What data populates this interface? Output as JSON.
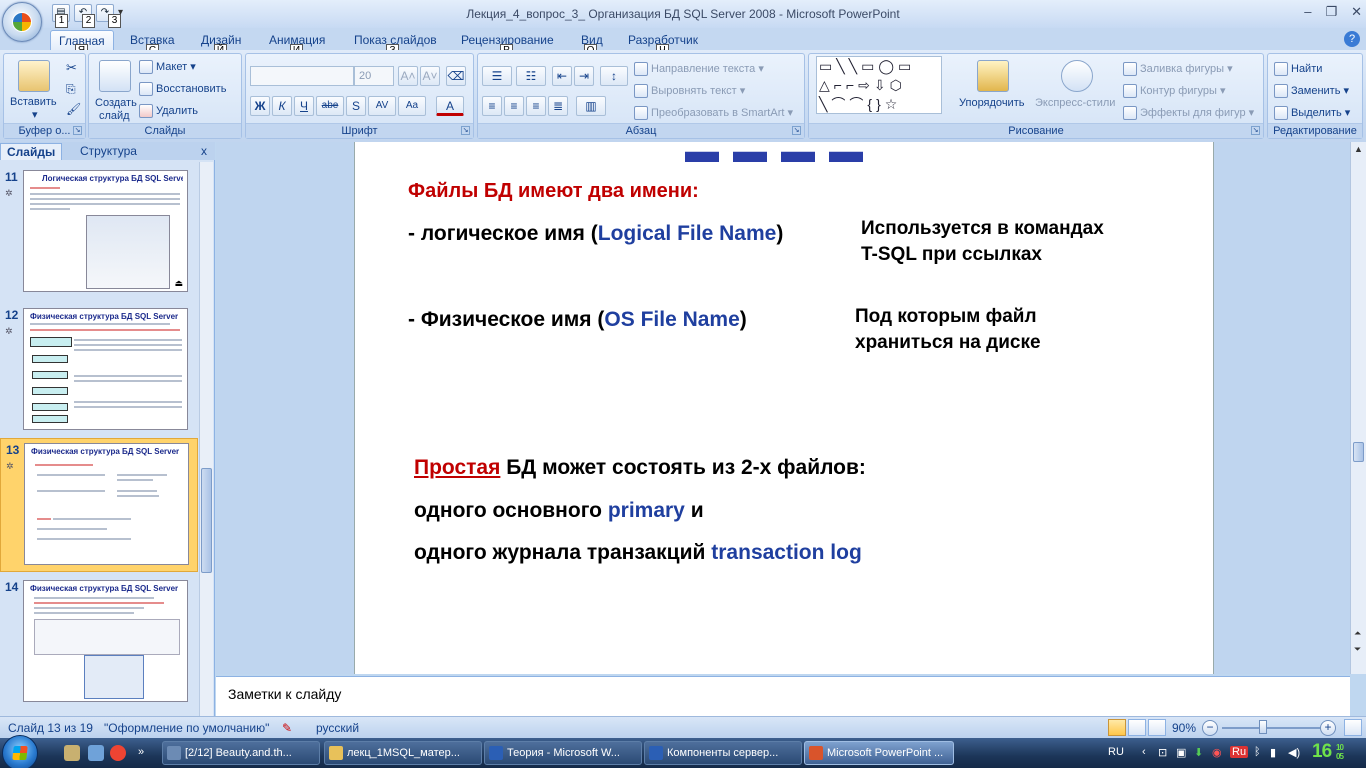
{
  "window": {
    "title": "Лекция_4_вопрос_3_ Организация БД SQL Server 2008 - Microsoft PowerPoint",
    "qat_keytips": [
      "1",
      "2",
      "3"
    ]
  },
  "ribbon": {
    "tabs": [
      {
        "label": "Главная",
        "keytip": "Я"
      },
      {
        "label": "Вставка",
        "keytip": "С"
      },
      {
        "label": "Дизайн",
        "keytip": "Й"
      },
      {
        "label": "Анимация",
        "keytip": "И"
      },
      {
        "label": "Показ слайдов",
        "keytip": "З"
      },
      {
        "label": "Рецензирование",
        "keytip": "Р"
      },
      {
        "label": "Вид",
        "keytip": "О"
      },
      {
        "label": "Разработчик",
        "keytip": "Ч"
      }
    ],
    "clipboard": {
      "paste": "Вставить",
      "label": "Буфер о..."
    },
    "slides": {
      "new_slide_1": "Создать",
      "new_slide_2": "слайд",
      "layout": "Макет",
      "reset": "Восстановить",
      "delete": "Удалить",
      "label": "Слайды"
    },
    "font": {
      "size": "20",
      "label": "Шрифт",
      "bold": "Ж",
      "italic": "К",
      "underline": "Ч",
      "strike": "abe",
      "shadow": "S",
      "spacing": "AV",
      "case": "Aa",
      "color": "A"
    },
    "paragraph": {
      "text_direction": "Направление текста",
      "align_text": "Выровнять текст",
      "smartart": "Преобразовать в SmartArt",
      "label": "Абзац"
    },
    "drawing": {
      "arrange": "Упорядочить",
      "quick_styles": "Экспресс-стили",
      "fill": "Заливка фигуры",
      "outline": "Контур фигуры",
      "effects": "Эффекты для фигур",
      "label": "Рисование"
    },
    "editing": {
      "find": "Найти",
      "replace": "Заменить",
      "select": "Выделить",
      "label": "Редактирование"
    }
  },
  "panel": {
    "tab_slides": "Слайды",
    "tab_outline": "Структура",
    "thumbnails": [
      {
        "num": "11",
        "title": "Логическая структура БД SQL Server"
      },
      {
        "num": "12",
        "title": "Физическая структура БД SQL Server"
      },
      {
        "num": "13",
        "title": "Физическая структура БД SQL Server"
      },
      {
        "num": "14",
        "title": "Физическая структура БД SQL Server"
      }
    ]
  },
  "slide": {
    "files_two_names": "Файлы БД имеют два имени:",
    "logical_prefix": "- логическое имя (",
    "logical_term": "Logical File Name",
    "close_paren": ")",
    "logical_note_1": "Используется в командах",
    "logical_note_2": "T-SQL при ссылках",
    "physical_prefix": "- Физическое имя (",
    "physical_term": "OS File Name",
    "physical_note_1": "Под которым файл",
    "physical_note_2": "храниться на диске",
    "simple_word": "Простая",
    "simple_rest": " БД может состоять из 2-х файлов:",
    "line2_a": "одного основного ",
    "line2_b": "primary",
    "line2_c": " и",
    "line3_a": "одного журнала транзакций ",
    "line3_b": "transaction log"
  },
  "notes": {
    "placeholder": "Заметки к слайду"
  },
  "status": {
    "slide_count": "Слайд 13 из 19",
    "theme": "\"Оформление по умолчанию\"",
    "language": "русский",
    "zoom": "90%"
  },
  "taskbar": {
    "items": [
      "[2/12] Beauty.and.th...",
      "лекц_1MSQL_матер...",
      "Теория - Microsoft W...",
      "Компоненты сервер...",
      "Microsoft PowerPoint ..."
    ],
    "lang": "RU",
    "lang_tray": "Ru",
    "clock_hour": "16",
    "clock_min_top": "10",
    "clock_min_bot": "05"
  },
  "colors": {
    "accent_red": "#c00000",
    "accent_blue": "#1f3f9f",
    "selected_thumb": "#ffd36b"
  }
}
